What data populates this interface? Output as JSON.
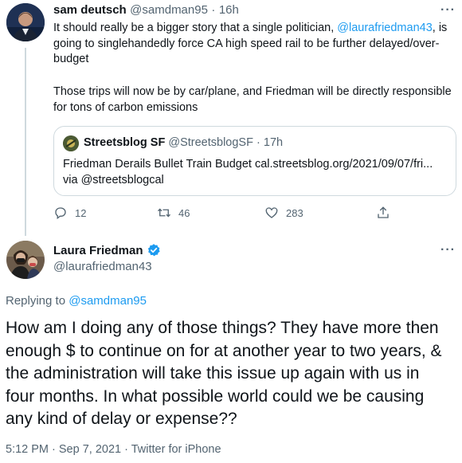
{
  "tweet1": {
    "display_name": "sam deutsch",
    "handle": "@samdman95",
    "separator": "·",
    "time": "16h",
    "text_part1": "It should really be a bigger story that a single politician, ",
    "mention": "@laurafriedman43",
    "text_part2": ", is going to singlehandedly force CA high speed rail to be further delayed/over-budget",
    "text_para2": "Those trips will now be by car/plane, and Friedman will be directly responsible for tons of carbon emissions",
    "quote": {
      "display_name": "Streetsblog SF",
      "handle": "@StreetsblogSF",
      "separator": "·",
      "time": "17h",
      "line1": "Friedman Derails Bullet Train Budget cal.streetsblog.org/2021/09/07/fri...",
      "line2": "via @streetsblogcal"
    },
    "replies": "12",
    "retweets": "46",
    "likes": "283",
    "more": "···"
  },
  "tweet2": {
    "display_name": "Laura Friedman",
    "handle": "@laurafriedman43",
    "replying_label": "Replying to ",
    "replying_to": "@samdman95",
    "text": "How am I doing any of those things? They have more then enough $ to continue on for at another year to two years, & the administration will take this issue up again with us in four months. In what possible world could we be causing any kind of delay or expense??",
    "timestamp": "5:12 PM · Sep 7, 2021 · Twitter for iPhone",
    "more": "···"
  },
  "colors": {
    "accent": "#1d9bf0",
    "muted": "#536471",
    "border": "#cfd9de"
  },
  "icons": {
    "reply": "reply-icon",
    "retweet": "retweet-icon",
    "like": "heart-icon",
    "share": "share-icon",
    "verified": "verified-badge-icon"
  }
}
